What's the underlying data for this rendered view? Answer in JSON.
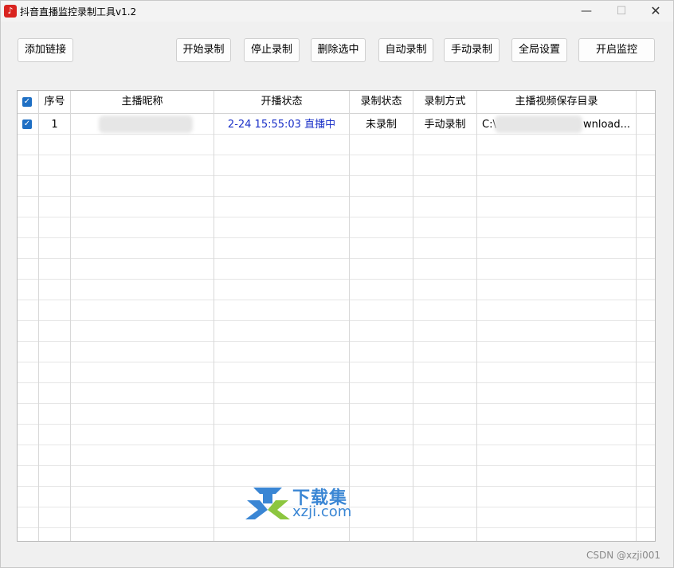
{
  "window": {
    "title": "抖音直播监控录制工具v1.2",
    "icon": "douyin-logo-icon",
    "controls": {
      "minimize": "—",
      "maximize": "☐",
      "close": "✕"
    }
  },
  "toolbar": {
    "add_link": "添加链接",
    "start_record": "开始录制",
    "stop_record": "停止录制",
    "delete_selected": "删除选中",
    "auto_record": "自动录制",
    "manual_record": "手动录制",
    "global_settings": "全局设置",
    "start_monitor": "开启监控"
  },
  "table": {
    "headers": {
      "index": "序号",
      "nickname": "主播昵称",
      "live_status": "开播状态",
      "record_status": "录制状态",
      "record_mode": "录制方式",
      "save_dir": "主播视频保存目录"
    },
    "rows": [
      {
        "checked": true,
        "index": "1",
        "nickname": "",
        "live_status": "2-24 15:55:03 直播中",
        "record_status": "未录制",
        "record_mode": "手动录制",
        "save_dir_prefix": "C:\\",
        "save_dir_suffix": "wnload..."
      }
    ],
    "accent_color": "#1e6fc4",
    "live_status_color": "#1a30c8"
  },
  "watermark": {
    "title": "下载集",
    "site": "xzji.com"
  },
  "footer": {
    "credit": "CSDN @xzji001"
  }
}
